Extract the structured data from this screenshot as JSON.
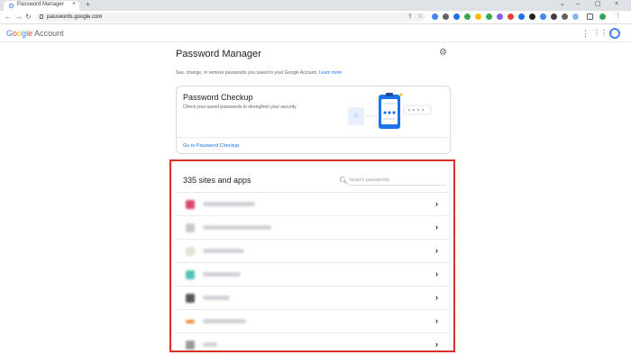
{
  "browser": {
    "tab_title": "Password Manager",
    "tab_close": "×",
    "new_tab": "+",
    "url": "passwords.google.com",
    "window_controls": [
      "⌄",
      "–",
      "▢",
      "×"
    ]
  },
  "header": {
    "logo_google": "Google",
    "logo_account": "Account"
  },
  "main": {
    "title": "Password Manager",
    "description": "See, change, or remove passwords you saved in your Google Account.",
    "learn_more": "Learn more"
  },
  "checkup": {
    "title": "Password Checkup",
    "description": "Check your saved passwords to strengthen your security",
    "link": "Go to Password Checkup"
  },
  "passwords": {
    "count_label": "335 sites and apps",
    "search_placeholder": "Search passwords",
    "rows": [
      {
        "favicon_color": "#d9476a"
      },
      {
        "favicon_color": "#c8c8c8"
      },
      {
        "favicon_color": "#e6e0d0"
      },
      {
        "favicon_color": "#56c2b8"
      },
      {
        "favicon_color": "#555555"
      },
      {
        "favicon_color": "#f08a3c"
      },
      {
        "favicon_color": "#9a9a9a"
      }
    ]
  },
  "colors": {
    "accent": "#1a73e8",
    "highlight": "#d93025"
  }
}
